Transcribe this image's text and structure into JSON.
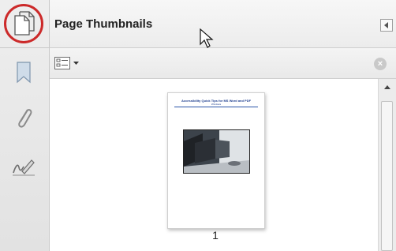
{
  "panel": {
    "title": "Page Thumbnails",
    "rail_icons": [
      "page-thumbnails-icon",
      "bookmark-icon",
      "attachment-icon",
      "signature-icon"
    ],
    "highlight_color": "#cc2a2a"
  },
  "toolbar": {
    "options_icon": "thumbnail-options-icon",
    "close_icon": "close-circle-icon"
  },
  "thumbnails": [
    {
      "page_number": "1",
      "title": "Accessibility Quick Tips for MS Word and PDF",
      "subtitle": "Windows"
    }
  ]
}
